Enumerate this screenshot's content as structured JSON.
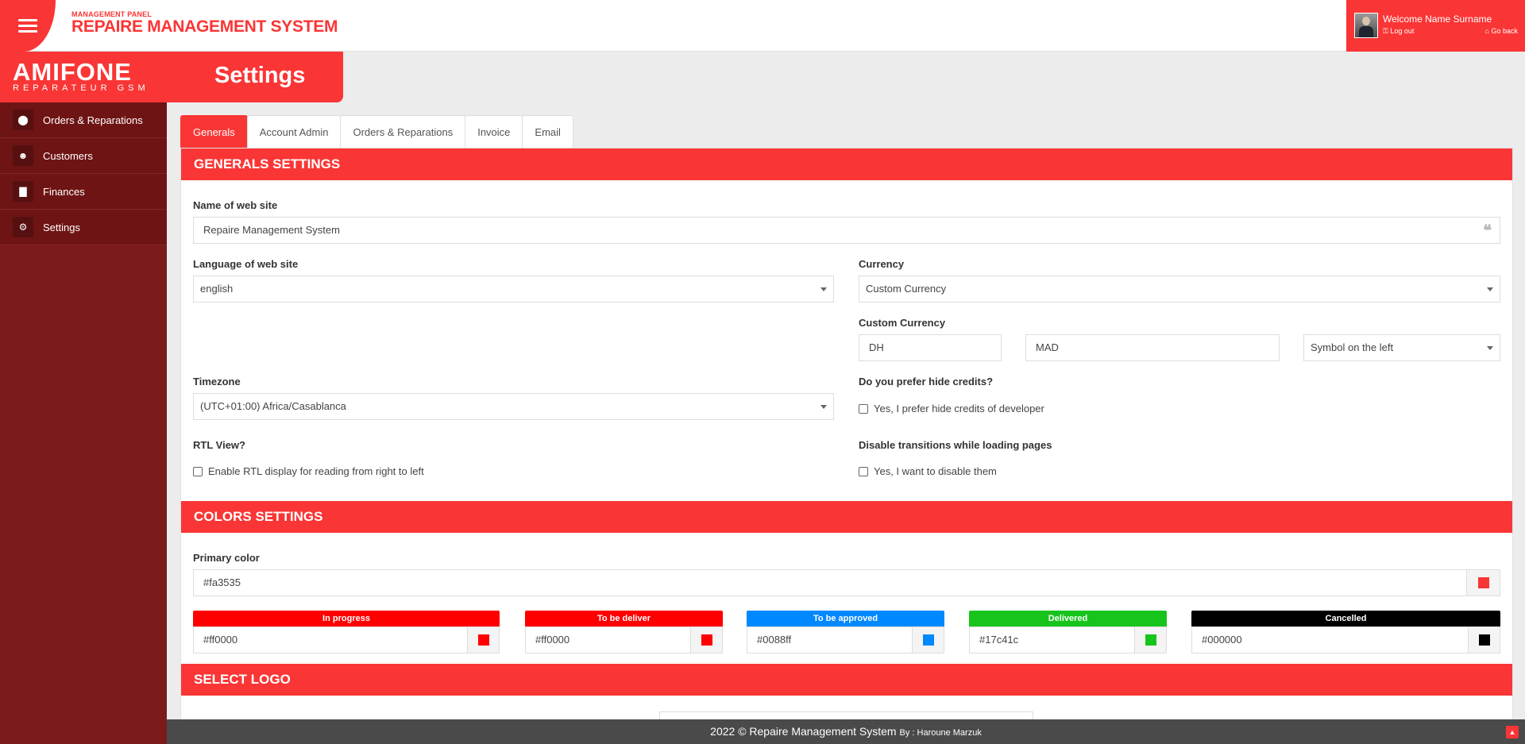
{
  "header": {
    "panel_label": "MANAGEMENT PANEL",
    "app_title": "REPAIRE MANAGEMENT SYSTEM",
    "welcome": "Welcome Name Surname",
    "logout": "Log out",
    "goback": "Go back"
  },
  "logo": {
    "main": "AMIFONE",
    "sub": "REPARATEUR GSM"
  },
  "page_title": "Settings",
  "sidebar": {
    "items": [
      {
        "label": "Orders & Reparations",
        "icon": "map-marker-icon"
      },
      {
        "label": "Customers",
        "icon": "user-icon"
      },
      {
        "label": "Finances",
        "icon": "bar-chart-icon"
      },
      {
        "label": "Settings",
        "icon": "gear-icon"
      }
    ]
  },
  "tabs": [
    "Generals",
    "Account Admin",
    "Orders & Reparations",
    "Invoice",
    "Email"
  ],
  "generals": {
    "heading": "GENERALS SETTINGS",
    "site_name_label": "Name of web site",
    "site_name_value": "Repaire Management System",
    "language_label": "Language of web site",
    "language_value": "english",
    "currency_label": "Currency",
    "currency_value": "Custom Currency",
    "custom_currency_label": "Custom Currency",
    "custom_currency_symbol": "DH",
    "custom_currency_code": "MAD",
    "symbol_position": "Symbol on the left",
    "timezone_label": "Timezone",
    "timezone_value": "(UTC+01:00) Africa/Casablanca",
    "hide_credits_label": "Do you prefer hide credits?",
    "hide_credits_option": "Yes, I prefer hide credits of developer",
    "rtl_label": "RTL View?",
    "rtl_option": "Enable RTL display for reading from right to left",
    "transitions_label": "Disable transitions while loading pages",
    "transitions_option": "Yes, I want to disable them"
  },
  "colors": {
    "heading": "COLORS SETTINGS",
    "primary_label": "Primary color",
    "primary_value": "#fa3535",
    "statuses": [
      {
        "label": "In progress",
        "value": "#ff0000"
      },
      {
        "label": "To be deliver",
        "value": "#ff0000"
      },
      {
        "label": "To be approved",
        "value": "#0088ff"
      },
      {
        "label": "Delivered",
        "value": "#17c41c"
      },
      {
        "label": "Cancelled",
        "value": "#000000"
      }
    ]
  },
  "logo_section": {
    "heading": "SELECT LOGO"
  },
  "footer": {
    "text": "2022 © Repaire Management System",
    "by": "By : Haroune Marzuk"
  },
  "theme": {
    "accent": "#fa3535",
    "sidebar": "#7a1a1a"
  }
}
